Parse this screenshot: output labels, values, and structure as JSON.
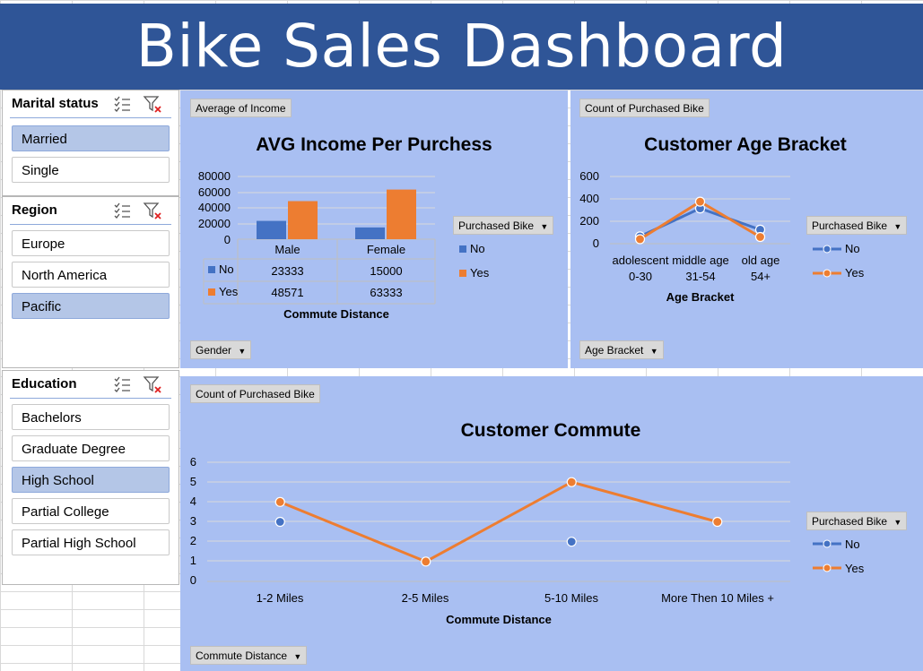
{
  "dashboard": {
    "title": "Bike Sales Dashboard"
  },
  "slicers": {
    "marital": {
      "title": "Marital status",
      "items": [
        {
          "label": "Married",
          "selected": true
        },
        {
          "label": "Single",
          "selected": false
        }
      ]
    },
    "region": {
      "title": "Region",
      "items": [
        {
          "label": "Europe",
          "selected": false
        },
        {
          "label": "North America",
          "selected": false
        },
        {
          "label": "Pacific",
          "selected": true
        }
      ]
    },
    "education": {
      "title": "Education",
      "items": [
        {
          "label": "Bachelors",
          "selected": false
        },
        {
          "label": "Graduate Degree",
          "selected": false
        },
        {
          "label": "High School",
          "selected": true
        },
        {
          "label": "Partial College",
          "selected": false
        },
        {
          "label": "Partial High School",
          "selected": false
        }
      ]
    }
  },
  "income_chart": {
    "value_button": "Average of Income",
    "axis_button": "Gender",
    "legend_button": "Purchased Bike",
    "xlabel": "Commute Distance",
    "y_ticks": [
      "80000",
      "60000",
      "40000",
      "20000",
      "0"
    ],
    "table": {
      "no_label": "No",
      "yes_label": "Yes",
      "no_values": [
        "23333",
        "15000"
      ],
      "yes_values": [
        "48571",
        "63333"
      ]
    },
    "legend": [
      "No",
      "Yes"
    ]
  },
  "age_chart": {
    "value_button": "Count of Purchased Bike",
    "axis_button": "Age Bracket",
    "legend_button": "Purchased Bike",
    "y_ticks": [
      "600",
      "400",
      "200",
      "0"
    ],
    "x_labels": [
      {
        "line1": "adolescent",
        "line2": "0-30"
      },
      {
        "line1": "middle age",
        "line2": "31-54"
      },
      {
        "line1": "old age",
        "line2": "54+"
      }
    ],
    "legend": [
      "No",
      "Yes"
    ]
  },
  "commute_chart": {
    "value_button": "Count of Purchased Bike",
    "axis_button": "Commute Distance",
    "legend_button": "Purchased Bike",
    "y_ticks": [
      "6",
      "5",
      "4",
      "3",
      "2",
      "1",
      "0"
    ],
    "legend": [
      "No",
      "Yes"
    ]
  },
  "colors": {
    "title_bar": "#2f5597",
    "chart_bg": "#a9bff2",
    "no": "#4472c4",
    "yes": "#ed7d31"
  },
  "chart_data": [
    {
      "type": "bar",
      "title": "AVG Income Per Purchess",
      "categories": [
        "Male",
        "Female"
      ],
      "series": [
        {
          "name": "No",
          "values": [
            23333,
            15000
          ]
        },
        {
          "name": "Yes",
          "values": [
            48571,
            63333
          ]
        }
      ],
      "xlabel": "Commute Distance",
      "ylim": [
        0,
        80000
      ],
      "grid": true,
      "legend": "right"
    },
    {
      "type": "line",
      "title": "Customer Age Bracket",
      "categories": [
        "adolescent 0-30",
        "middle age 31-54",
        "old age 54+"
      ],
      "series": [
        {
          "name": "No",
          "values": [
            65,
            315,
            125
          ]
        },
        {
          "name": "Yes",
          "values": [
            40,
            375,
            60
          ]
        }
      ],
      "xlabel": "Age Bracket",
      "ylim": [
        0,
        600
      ],
      "grid": true,
      "legend": "right"
    },
    {
      "type": "line",
      "title": "Customer Commute",
      "categories": [
        "1-2 Miles",
        "2-5 Miles",
        "5-10 Miles",
        "More Then 10 Miles +"
      ],
      "series": [
        {
          "name": "No",
          "values": [
            3,
            null,
            2,
            null
          ]
        },
        {
          "name": "Yes",
          "values": [
            4,
            1,
            5,
            3
          ]
        }
      ],
      "xlabel": "Commute Distance",
      "ylim": [
        0,
        6
      ],
      "grid": true,
      "legend": "right"
    }
  ]
}
